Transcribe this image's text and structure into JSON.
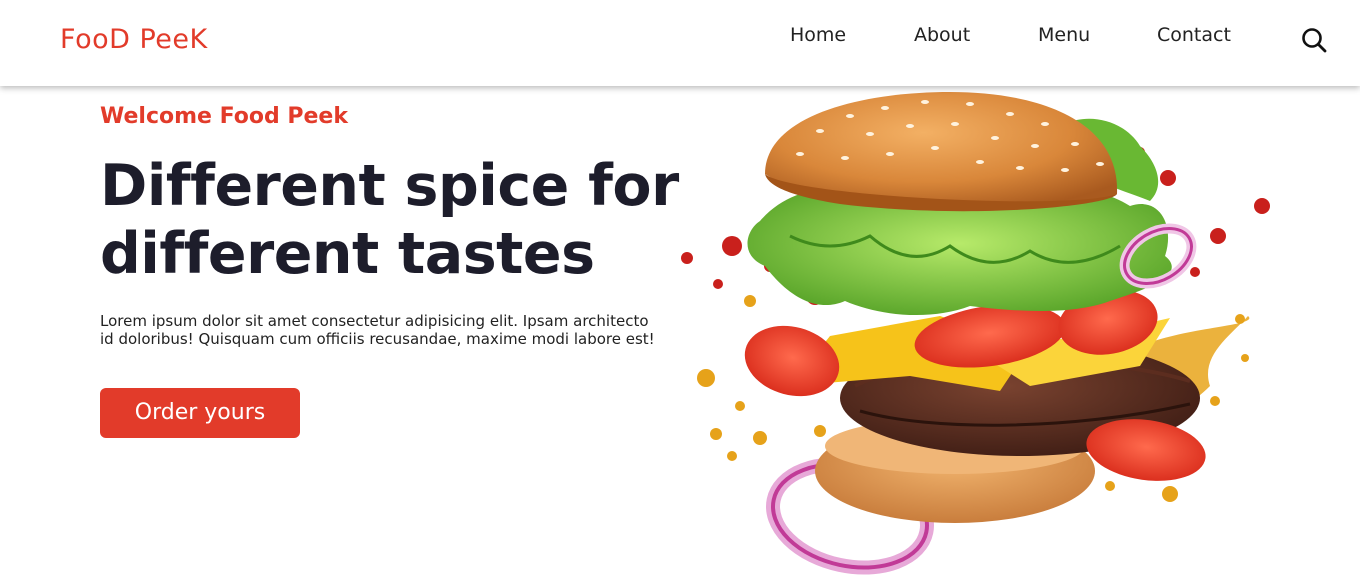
{
  "brand": {
    "part1": "Foo",
    "part2": "D",
    "part3": " Pee",
    "part4": "K"
  },
  "nav": {
    "items": [
      {
        "label": "Home"
      },
      {
        "label": "About"
      },
      {
        "label": "Menu"
      },
      {
        "label": "Contact"
      }
    ],
    "search_icon": "search-icon"
  },
  "hero": {
    "welcome": "Welcome Food Peek",
    "headline": "Different spice for different tastes",
    "description": "Lorem ipsum dolor sit amet consectetur adipisicing elit. Ipsam architecto id doloribus! Quisquam cum officiis recusandae, maxime modi labore est!",
    "cta_label": "Order yours",
    "image": "burger-image"
  },
  "colors": {
    "accent": "#e23b2a",
    "text": "#1d1d2b",
    "background": "#ffffff"
  }
}
